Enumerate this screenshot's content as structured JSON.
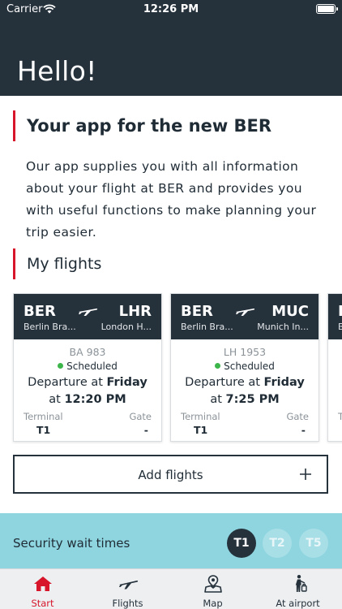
{
  "status_bar": {
    "carrier": "Carrier",
    "time": "12:26 PM"
  },
  "header": {
    "greeting": "Hello!"
  },
  "intro": {
    "title": "Your app for the new BER",
    "text": "Our app supplies you with all information about your flight at BER and provides you with useful functions to make planning your trip easier."
  },
  "my_flights": {
    "title": "My flights",
    "cards": [
      {
        "from_code": "BER",
        "from_city": "Berlin Bra...",
        "to_code": "LHR",
        "to_city": "London H...",
        "flight_number": "BA 983",
        "status": "Scheduled",
        "departure_prefix": "Departure at",
        "departure_day": "Friday",
        "time_prefix": "at",
        "departure_time": "12:20 PM",
        "terminal_label": "Terminal",
        "terminal": "T1",
        "gate_label": "Gate",
        "gate": "-"
      },
      {
        "from_code": "BER",
        "from_city": "Berlin Bra...",
        "to_code": "MUC",
        "to_city": "Munich In...",
        "flight_number": "LH 1953",
        "status": "Scheduled",
        "departure_prefix": "Departure at",
        "departure_day": "Friday",
        "time_prefix": "at",
        "departure_time": "7:25 PM",
        "terminal_label": "Terminal",
        "terminal": "T1",
        "gate_label": "Gate",
        "gate": "-"
      },
      {
        "from_code": "B",
        "from_city": "B",
        "to_code": "",
        "to_city": "",
        "flight_number": "",
        "status": "",
        "departure_prefix": "",
        "departure_day": "",
        "time_prefix": "",
        "departure_time": "",
        "terminal_label": "T",
        "terminal": "",
        "gate_label": "",
        "gate": ""
      }
    ]
  },
  "add_flights": {
    "label": "Add flights"
  },
  "security": {
    "label": "Security wait times",
    "terminals": [
      "T1",
      "T2",
      "T5"
    ],
    "selected": "T1"
  },
  "tabbar": {
    "items": [
      {
        "label": "Start",
        "icon": "home-icon",
        "active": true
      },
      {
        "label": "Flights",
        "icon": "plane-icon",
        "active": false
      },
      {
        "label": "Map",
        "icon": "map-pin-icon",
        "active": false
      },
      {
        "label": "At airport",
        "icon": "person-luggage-icon",
        "active": false
      }
    ]
  },
  "colors": {
    "header_bg": "#25313b",
    "accent_red": "#d7162b",
    "security_bg": "#8ed5df",
    "status_green": "#3cb54a"
  }
}
